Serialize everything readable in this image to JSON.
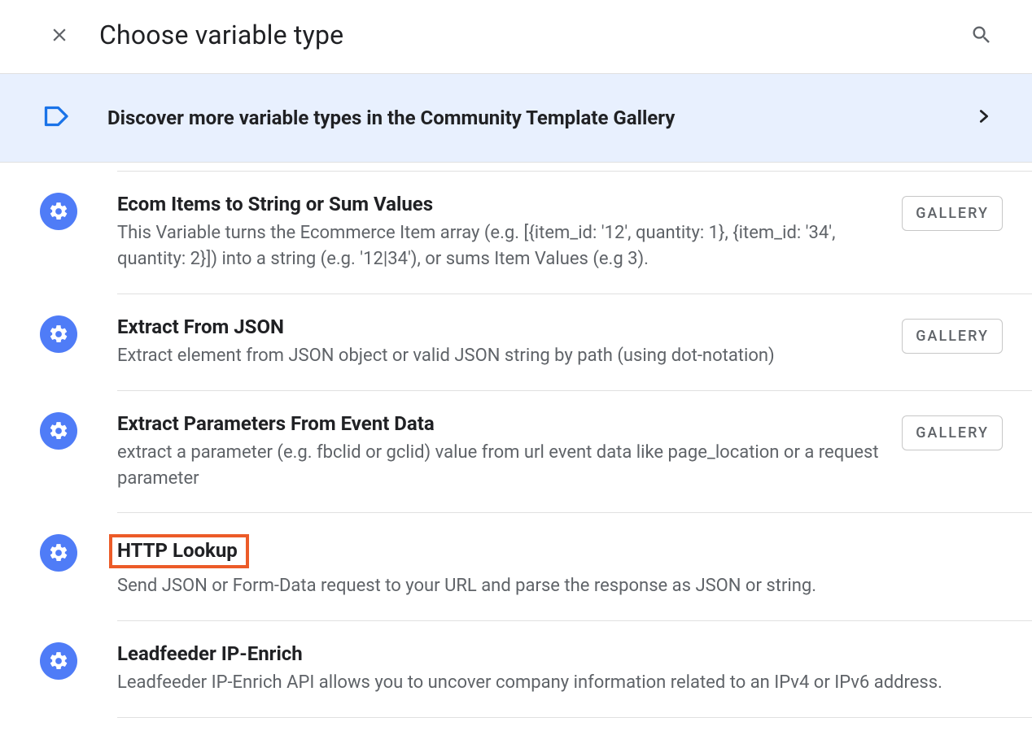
{
  "header": {
    "title": "Choose variable type"
  },
  "banner": {
    "text": "Discover more variable types in the Community Template Gallery"
  },
  "gallery_label": "GALLERY",
  "items": [
    {
      "title": "Ecom Items to String or Sum Values",
      "desc": "This Variable turns the Ecommerce Item array (e.g. [{item_id: '12', quantity: 1}, {item_id: '34', quantity: 2}]) into a string (e.g. '12|34'), or sums Item Values (e.g 3).",
      "badge": true,
      "highlighted": false
    },
    {
      "title": "Extract From JSON",
      "desc": "Extract element from JSON object or valid JSON string by path (using dot-notation)",
      "badge": true,
      "highlighted": false
    },
    {
      "title": "Extract Parameters From Event Data",
      "desc": "extract a parameter (e.g. fbclid or gclid) value from url event data like page_location or a request parameter",
      "badge": true,
      "highlighted": false
    },
    {
      "title": "HTTP Lookup",
      "desc": "Send JSON or Form-Data request to your URL and parse the response as JSON or string.",
      "badge": false,
      "highlighted": true
    },
    {
      "title": "Leadfeeder IP-Enrich",
      "desc": "Leadfeeder IP-Enrich API allows you to uncover company information related to an IPv4 or IPv6 address.",
      "badge": false,
      "highlighted": false
    }
  ]
}
